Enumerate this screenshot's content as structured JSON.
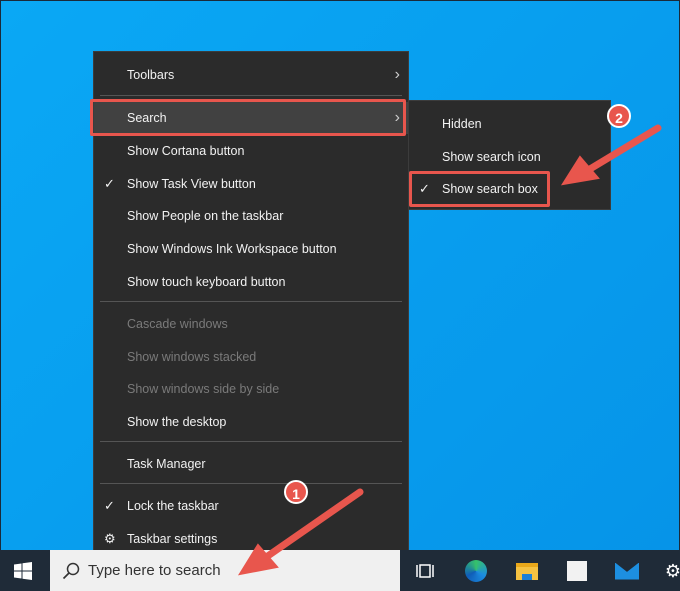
{
  "context_menu": {
    "items": [
      {
        "label": "Toolbars",
        "submenu": true
      },
      {
        "label": "Search",
        "submenu": true,
        "highlighted": true
      },
      {
        "label": "Show Cortana button"
      },
      {
        "label": "Show Task View button",
        "checked": true
      },
      {
        "label": "Show People on the taskbar"
      },
      {
        "label": "Show Windows Ink Workspace button"
      },
      {
        "label": "Show touch keyboard button"
      },
      {
        "label": "Cascade windows",
        "disabled": true
      },
      {
        "label": "Show windows stacked",
        "disabled": true
      },
      {
        "label": "Show windows side by side",
        "disabled": true
      },
      {
        "label": "Show the desktop"
      },
      {
        "label": "Task Manager"
      },
      {
        "label": "Lock the taskbar",
        "checked": true
      },
      {
        "label": "Taskbar settings",
        "icon": "gear-icon"
      }
    ]
  },
  "search_submenu": {
    "items": [
      {
        "label": "Hidden"
      },
      {
        "label": "Show search icon"
      },
      {
        "label": "Show search box",
        "checked": true,
        "highlighted": true
      }
    ]
  },
  "taskbar": {
    "search_placeholder": "Type here to search"
  },
  "annotations": {
    "badge1": "1",
    "badge2": "2",
    "color": "#e8564d"
  },
  "glyphs": {
    "check": "✓",
    "chevron": "›",
    "gear": "⚙"
  }
}
